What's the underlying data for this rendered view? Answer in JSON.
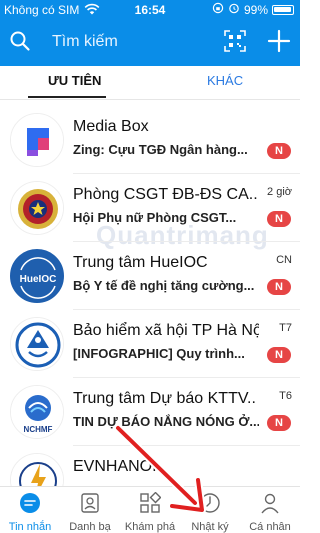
{
  "status_bar": {
    "carrier": "Không có SIM",
    "time": "16:54",
    "battery": "99%"
  },
  "search": {
    "placeholder": "Tìm kiếm"
  },
  "tabs": [
    {
      "label": "ƯU TIÊN"
    },
    {
      "label": "KHÁC"
    }
  ],
  "watermark": "Quantrimang",
  "chats": [
    {
      "title": "Media Box",
      "preview": "Zing: Cựu TGĐ Ngân hàng...",
      "time": "",
      "badge": "N",
      "avatar": "media-box-logo"
    },
    {
      "title": "Phòng CSGT ĐB-ĐS CA...",
      "preview": "Hội Phụ nữ Phòng CSGT...",
      "time": "2 giờ",
      "badge": "N",
      "avatar": "csgt-emblem"
    },
    {
      "title": "Trung tâm HueIOC",
      "preview": "Bộ Y tế đề nghị tăng cường...",
      "time": "CN",
      "badge": "N",
      "avatar": "hueioc-logo",
      "avatar_text": "HueIOC"
    },
    {
      "title": "Bảo hiểm xã hội TP Hà Nội",
      "preview": "[INFOGRAPHIC] Quy trình...",
      "time": "T7",
      "badge": "N",
      "avatar": "bhxh-logo"
    },
    {
      "title": "Trung tâm Dự báo KTTV...",
      "preview": "TIN DỰ BÁO NẮNG NÓNG Ở...",
      "time": "T6",
      "badge": "N",
      "avatar": "nchmf-logo",
      "avatar_text": "NCHMF"
    },
    {
      "title": "EVNHANOI",
      "preview": "",
      "time": "",
      "badge": "",
      "avatar": "evn-logo"
    }
  ],
  "bottom_nav": [
    {
      "label": "Tin nhắn",
      "icon": "chat-icon",
      "active": true
    },
    {
      "label": "Danh bạ",
      "icon": "contacts-icon",
      "active": false
    },
    {
      "label": "Khám phá",
      "icon": "discover-icon",
      "active": false
    },
    {
      "label": "Nhật ký",
      "icon": "clock-icon",
      "active": false
    },
    {
      "label": "Cá nhân",
      "icon": "person-icon",
      "active": false
    }
  ],
  "colors": {
    "accent": "#0a8de8",
    "badge": "#e64545",
    "annotation_arrow": "#e02020"
  }
}
